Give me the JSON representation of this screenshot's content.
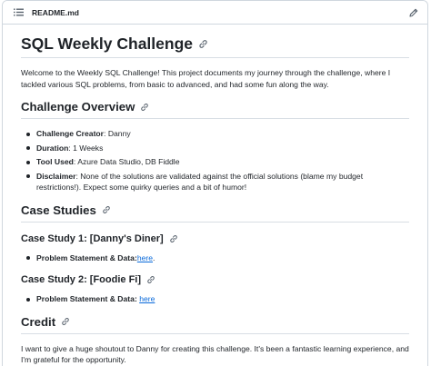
{
  "file": {
    "name": "README.md",
    "icons": {
      "outline": "list-icon",
      "edit": "pencil-icon",
      "anchor": "link-icon"
    }
  },
  "readme": {
    "title": "SQL Weekly Challenge",
    "intro": "Welcome to the Weekly SQL Challenge! This project documents my journey through the challenge, where I tackled various SQL problems, from basic to advanced, and had some fun along the way.",
    "overview": {
      "heading": "Challenge Overview",
      "items": [
        {
          "label": "Challenge Creator",
          "sep": ": ",
          "value": "Danny"
        },
        {
          "label": "Duration",
          "sep": ": ",
          "value": "1 Weeks"
        },
        {
          "label": "Tool Used",
          "sep": ": ",
          "value": "Azure Data Studio, DB Fiddle"
        },
        {
          "label": "Disclaimer",
          "sep": ": ",
          "value": "None of the solutions are validated against the official solutions (blame my budget restrictions!). Expect some quirky queries and a bit of humor!"
        }
      ]
    },
    "case_studies": {
      "heading": "Case Studies",
      "studies": [
        {
          "title": "Case Study 1: [Danny's Diner]",
          "label": "Problem Statement & Data",
          "sep": ":",
          "link": "here",
          "suffix": "."
        },
        {
          "title": "Case Study 2: [Foodie Fi]",
          "label": "Problem Statement & Data",
          "sep": ": ",
          "link": "here",
          "suffix": ""
        }
      ]
    },
    "credit": {
      "heading": "Credit",
      "text": "I want to give a huge shoutout to Danny for creating this challenge. It's been a fantastic learning experience, and I'm grateful for the opportunity."
    }
  }
}
